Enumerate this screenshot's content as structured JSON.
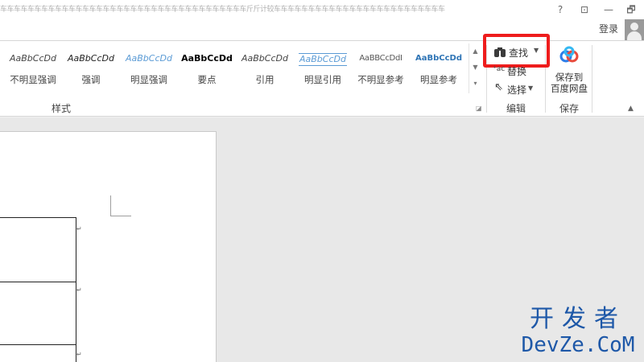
{
  "window": {
    "title_garbled": "车车车车车车车车车车车车车车车车车车车车车车车车车车车车车车车车车车车车斤斤计较车车车车车车车车车车车车车车车车车车车车车车车车车",
    "buttons": {
      "help": "?",
      "restore_ribbon": "⊡",
      "minimize": "—",
      "maximize": "🗗"
    }
  },
  "account": {
    "login_label": "登录"
  },
  "styles_gallery": {
    "items": [
      {
        "sample": "AaBbCcDd",
        "name": "不明显强调",
        "color": "#444444"
      },
      {
        "sample": "AaBbCcDd",
        "name": "强调",
        "color": "#333333"
      },
      {
        "sample": "AaBbCcDd",
        "name": "明显强调",
        "color": "#5b9bd5"
      },
      {
        "sample": "AaBbCcDd",
        "name": "要点",
        "color": "#000000"
      },
      {
        "sample": "AaBbCcDd",
        "name": "引用",
        "color": "#444444"
      },
      {
        "sample": "AaBbCcDd",
        "name": "明显引用",
        "color": "#5b9bd5"
      },
      {
        "sample": "AaBBCcDdI",
        "name": "不明显参考",
        "color": "#555555"
      },
      {
        "sample": "AaBbCcDd",
        "name": "明显参考",
        "color": "#2e74b5"
      }
    ],
    "group_label": "样式"
  },
  "editing": {
    "find_label": "查找",
    "replace_label": "替换",
    "select_label": "选择",
    "group_label": "编辑"
  },
  "save": {
    "button_label_line1": "保存到",
    "button_label_line2": "百度网盘",
    "group_label": "保存"
  },
  "watermark": {
    "line1": "开发者",
    "line2": "DevZe.CoM"
  },
  "colors": {
    "highlight": "#ee1c1c",
    "accent": "#5b9bd5",
    "watermark": "#1e58a8"
  }
}
